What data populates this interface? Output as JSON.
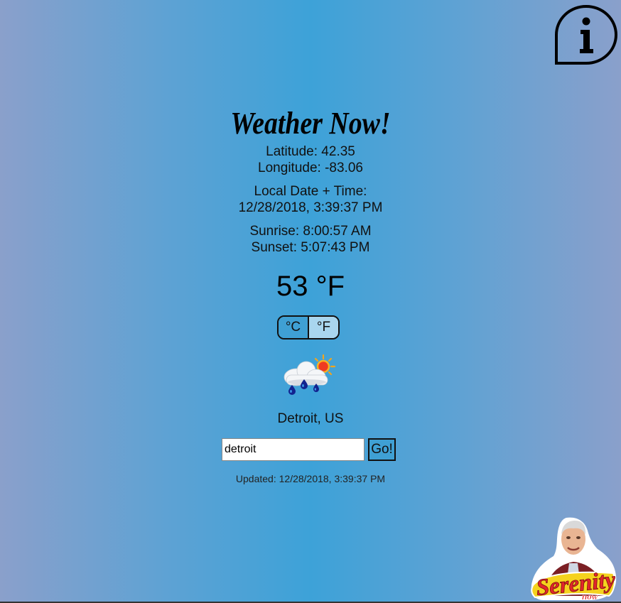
{
  "app": {
    "title": "Weather Now!"
  },
  "location": {
    "latitude_label": "Latitude: 42.35",
    "longitude_label": "Longitude: -83.06",
    "city": "Detroit, US"
  },
  "time": {
    "local_heading": "Local Date + Time:",
    "local_value": "12/28/2018, 3:39:37 PM",
    "sunrise": "Sunrise: 8:00:57 AM",
    "sunset": "Sunset: 5:07:43 PM"
  },
  "weather": {
    "temperature": "53 °F",
    "icon": "rain-cloud-sun-icon"
  },
  "units": {
    "celsius_label": "°C",
    "fahrenheit_label": "°F",
    "selected": "°F"
  },
  "search": {
    "value": "detroit",
    "button_label": "Go!"
  },
  "status": {
    "updated": "Updated: 12/28/2018, 3:39:37 PM"
  },
  "logo": {
    "text": "Serenity",
    "subtext": "now"
  },
  "colors": {
    "background_center": "#3da2d8",
    "background_edge": "#8aa0cb",
    "toggle_selected": "#a9d6ee",
    "logo_red": "#e3262b",
    "logo_yellow": "#f5d21e"
  }
}
